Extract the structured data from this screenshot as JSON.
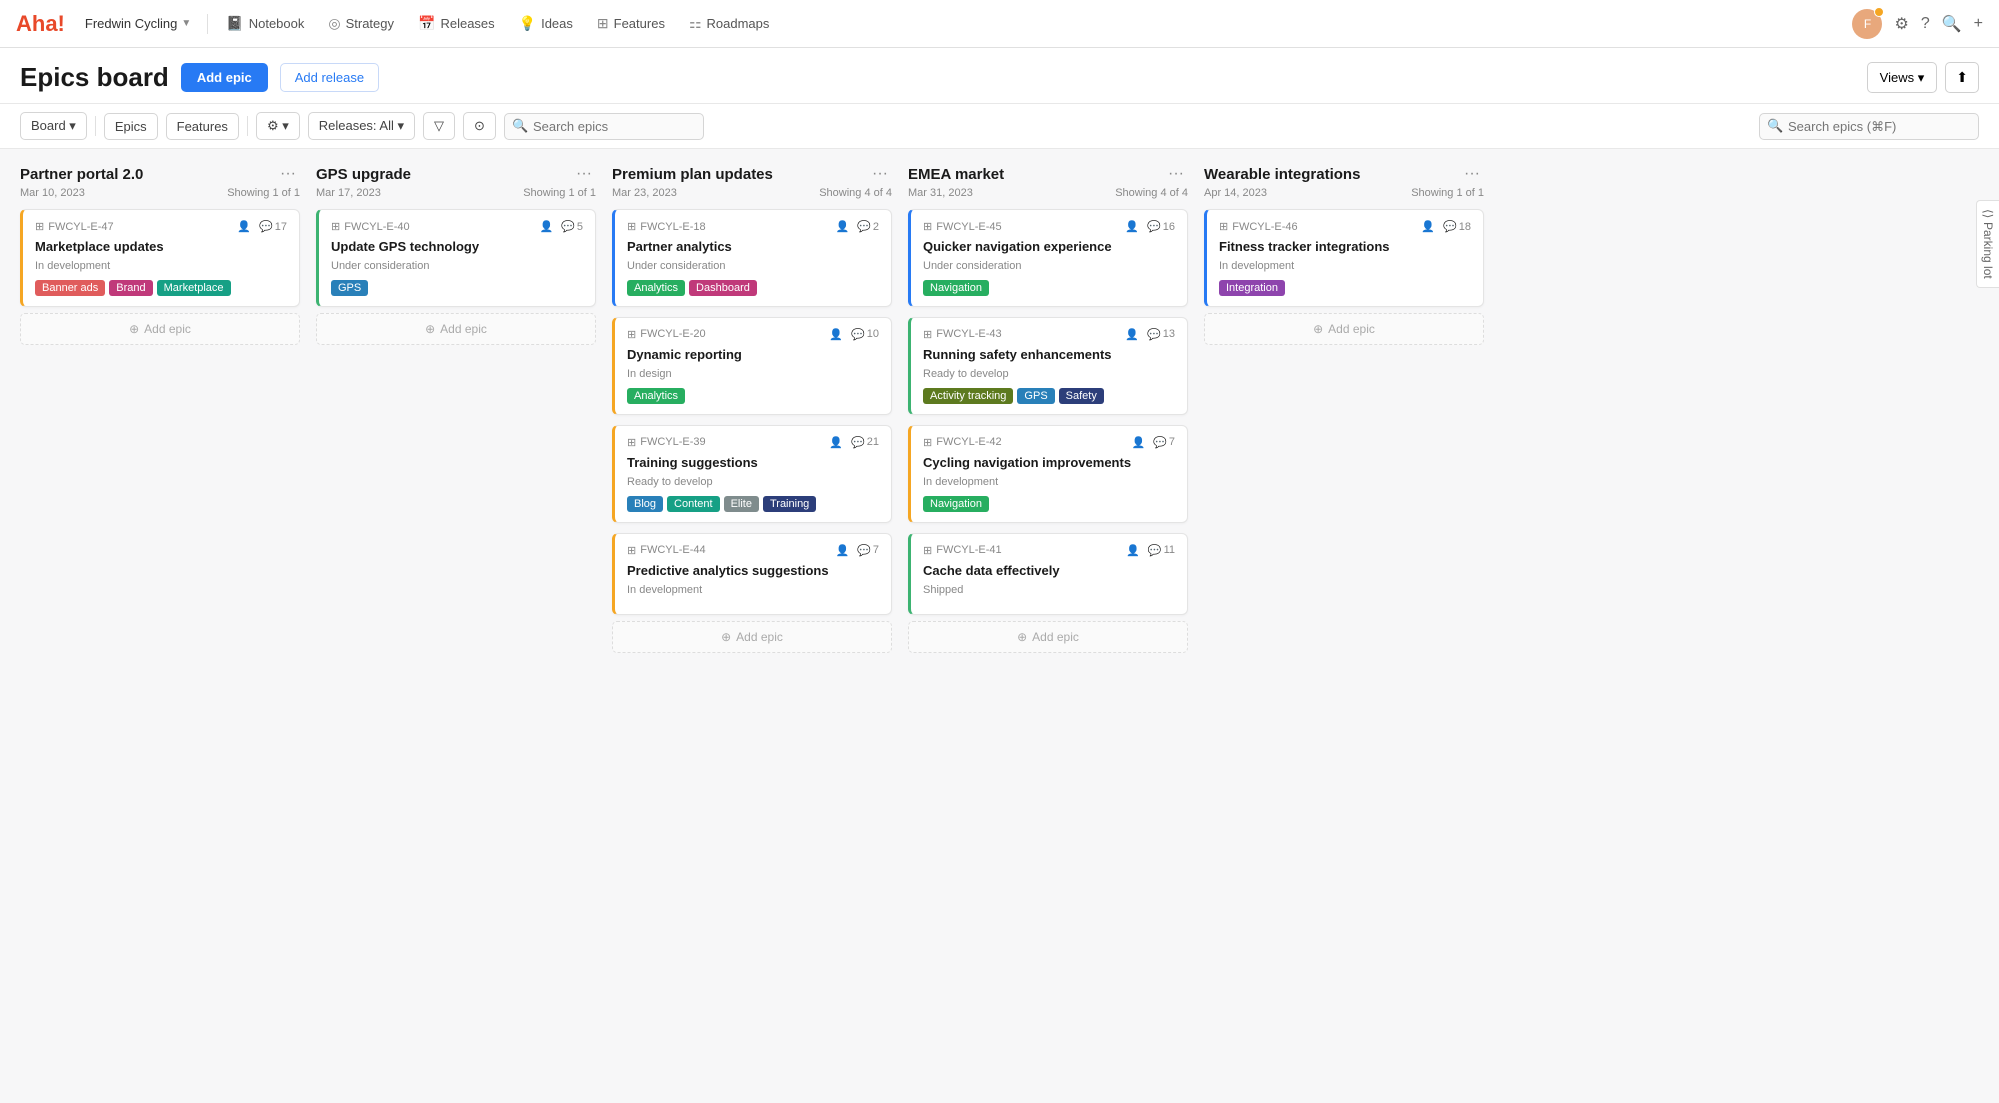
{
  "brand": "Aha!",
  "nav": {
    "workspace": "Fredwin Cycling",
    "items": [
      {
        "label": "Notebook",
        "icon": "📓"
      },
      {
        "label": "Strategy",
        "icon": "◎"
      },
      {
        "label": "Releases",
        "icon": "📅"
      },
      {
        "label": "Ideas",
        "icon": "💡"
      },
      {
        "label": "Features",
        "icon": "⊞"
      },
      {
        "label": "Roadmaps",
        "icon": "⚏"
      }
    ],
    "search_placeholder": "Search",
    "views_label": "Views ▾",
    "export_icon": "⬆"
  },
  "page": {
    "title": "Epics board",
    "add_epic_label": "Add epic",
    "add_release_label": "Add release"
  },
  "toolbar": {
    "board_label": "Board ▾",
    "epics_label": "Epics",
    "features_label": "Features",
    "settings_label": "⚙ ▾",
    "releases_label": "Releases: All ▾",
    "filter_icon": "⊿",
    "history_icon": "⊙",
    "search_placeholder": "Search epics",
    "search_global_placeholder": "Search epics (⌘F)"
  },
  "columns": [
    {
      "id": "col-partner-portal",
      "title": "Partner portal 2.0",
      "date": "Mar 10, 2023",
      "showing": "Showing 1 of 1",
      "cards": [
        {
          "id": "FWCYL-E-47",
          "icon": "⊞",
          "comment_count": "17",
          "people_icon": true,
          "title": "Marketplace updates",
          "status": "In development",
          "border": "border-orange",
          "tags": [
            {
              "label": "Banner ads",
              "color": "tag-red"
            },
            {
              "label": "Brand",
              "color": "tag-pink"
            },
            {
              "label": "Marketplace",
              "color": "tag-teal"
            }
          ]
        }
      ]
    },
    {
      "id": "col-gps-upgrade",
      "title": "GPS upgrade",
      "date": "Mar 17, 2023",
      "showing": "Showing 1 of 1",
      "cards": [
        {
          "id": "FWCYL-E-40",
          "icon": "⊞",
          "comment_count": "5",
          "people_icon": true,
          "title": "Update GPS technology",
          "status": "Under consideration",
          "border": "border-green",
          "tags": [
            {
              "label": "GPS",
              "color": "tag-blue"
            }
          ]
        }
      ]
    },
    {
      "id": "col-premium-plan",
      "title": "Premium plan updates",
      "date": "Mar 23, 2023",
      "showing": "Showing 4 of 4",
      "cards": [
        {
          "id": "FWCYL-E-18",
          "icon": "⊞",
          "comment_count": "2",
          "people_icon": true,
          "title": "Partner analytics",
          "status": "Under consideration",
          "border": "border-blue",
          "tags": [
            {
              "label": "Analytics",
              "color": "tag-green"
            },
            {
              "label": "Dashboard",
              "color": "tag-pink"
            }
          ]
        },
        {
          "id": "FWCYL-E-20",
          "icon": "⊞",
          "comment_count": "10",
          "people_icon": true,
          "title": "Dynamic reporting",
          "status": "In design",
          "border": "border-orange",
          "tags": [
            {
              "label": "Analytics",
              "color": "tag-green"
            }
          ]
        },
        {
          "id": "FWCYL-E-39",
          "icon": "⊞",
          "comment_count": "21",
          "people_icon": true,
          "title": "Training suggestions",
          "status": "Ready to develop",
          "border": "border-orange",
          "tags": [
            {
              "label": "Blog",
              "color": "tag-blue"
            },
            {
              "label": "Content",
              "color": "tag-teal"
            },
            {
              "label": "Elite",
              "color": "tag-gray"
            },
            {
              "label": "Training",
              "color": "tag-navy"
            }
          ]
        },
        {
          "id": "FWCYL-E-44",
          "icon": "⊞",
          "comment_count": "7",
          "people_icon": true,
          "title": "Predictive analytics suggestions",
          "status": "In development",
          "border": "border-orange",
          "tags": []
        }
      ]
    },
    {
      "id": "col-emea-market",
      "title": "EMEA market",
      "date": "Mar 31, 2023",
      "showing": "Showing 4 of 4",
      "cards": [
        {
          "id": "FWCYL-E-45",
          "icon": "⊞",
          "comment_count": "16",
          "people_icon": true,
          "title": "Quicker navigation experience",
          "status": "Under consideration",
          "border": "border-blue",
          "tags": [
            {
              "label": "Navigation",
              "color": "tag-green"
            }
          ]
        },
        {
          "id": "FWCYL-E-43",
          "icon": "⊞",
          "comment_count": "13",
          "people_icon": true,
          "title": "Running safety enhancements",
          "status": "Ready to develop",
          "border": "border-green",
          "tags": [
            {
              "label": "Activity tracking",
              "color": "tag-olive"
            },
            {
              "label": "GPS",
              "color": "tag-blue"
            },
            {
              "label": "Safety",
              "color": "tag-navy"
            }
          ]
        },
        {
          "id": "FWCYL-E-42",
          "icon": "⊞",
          "comment_count": "7",
          "people_icon": true,
          "title": "Cycling navigation improvements",
          "status": "In development",
          "border": "border-orange",
          "tags": [
            {
              "label": "Navigation",
              "color": "tag-green"
            }
          ]
        },
        {
          "id": "FWCYL-E-41",
          "icon": "⊞",
          "comment_count": "11",
          "people_icon": true,
          "title": "Cache data effectively",
          "status": "Shipped",
          "border": "border-green",
          "tags": []
        }
      ]
    },
    {
      "id": "col-wearable",
      "title": "Wearable integrations",
      "date": "Apr 14, 2023",
      "showing": "Showing 1 of 1",
      "cards": [
        {
          "id": "FWCYL-E-46",
          "icon": "⊞",
          "comment_count": "18",
          "people_icon": true,
          "title": "Fitness tracker integrations",
          "status": "In development",
          "border": "border-blue",
          "tags": [
            {
              "label": "Integration",
              "color": "tag-purple"
            }
          ]
        }
      ]
    }
  ],
  "add_epic_label": "+ Add epic",
  "parking_lot_label": "Parking lot"
}
